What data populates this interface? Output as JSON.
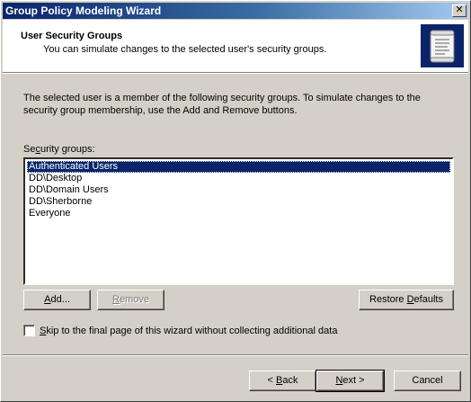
{
  "window": {
    "title": "Group Policy Modeling Wizard",
    "close_glyph": "✕"
  },
  "header": {
    "title": "User Security Groups",
    "subtitle": "You can simulate changes to the selected user's security groups."
  },
  "description": "The selected user is a member of the following security groups. To simulate changes to the security group membership, use the Add and Remove buttons.",
  "groups": {
    "label_pre": "Se",
    "label_key": "c",
    "label_post": "urity groups:",
    "items": [
      "Authenticated Users",
      "DD\\Desktop",
      "DD\\Domain Users",
      "DD\\Sherborne",
      "Everyone"
    ],
    "selected_index": 0
  },
  "buttons": {
    "add": {
      "key": "A",
      "rest": "dd..."
    },
    "remove": {
      "key": "R",
      "rest": "emove"
    },
    "restore": {
      "pre": "Restore ",
      "key": "D",
      "rest": "efaults"
    },
    "back": {
      "pre": "< ",
      "key": "B",
      "rest": "ack"
    },
    "next": {
      "key": "N",
      "rest": "ext >"
    },
    "cancel": "Cancel"
  },
  "skip_checkbox": {
    "pre": "",
    "key": "S",
    "rest": "kip to the final page of this wizard without collecting additional data",
    "checked": false
  },
  "icons": {
    "header": "scroll-document-icon",
    "close": "close-icon"
  },
  "colors": {
    "titlebar_start": "#0a246a",
    "titlebar_end": "#a6caf0",
    "selection": "#0a246a",
    "face": "#d4d0c8"
  }
}
